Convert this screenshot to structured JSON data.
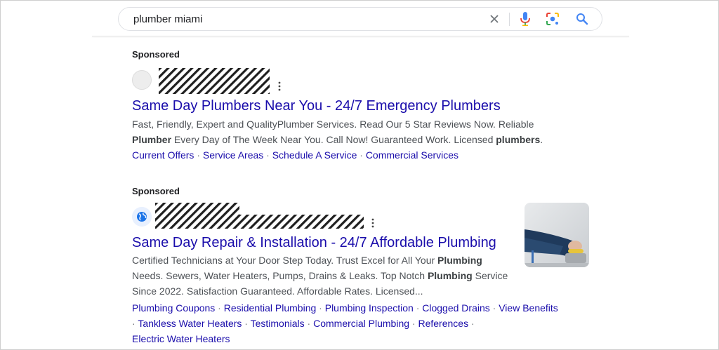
{
  "search": {
    "query": "plumber miami",
    "icons": [
      "close-icon",
      "mic-icon",
      "camera-lens-icon",
      "search-icon"
    ]
  },
  "ads": [
    {
      "sponsored_label": "Sponsored",
      "favicon": "blank-favicon",
      "title": "Same Day Plumbers Near You - 24/7 Emergency Plumbers",
      "description_lines": [
        [
          {
            "t": "Fast, Friendly, Expert and QualityPlumber Services. Read Our 5 Star Reviews Now. Reliable",
            "b": false
          }
        ],
        [
          {
            "t": "Plumber",
            "b": true
          },
          {
            "t": " Every Day of The Week Near You. Call Now! Guaranteed Work. Licensed ",
            "b": false
          },
          {
            "t": "plumbers",
            "b": true
          },
          {
            "t": ".",
            "b": false
          }
        ]
      ],
      "sitelink_lines": [
        [
          "Current Offers",
          "Service Areas",
          "Schedule A Service",
          "Commercial Services"
        ]
      ]
    },
    {
      "sponsored_label": "Sponsored",
      "favicon": "globe-favicon",
      "title": "Same Day Repair & Installation - 24/7 Affordable Plumbing",
      "description_lines": [
        [
          {
            "t": "Certified Technicians at Your Door Step Today. Trust Excel for All Your ",
            "b": false
          },
          {
            "t": "Plumbing",
            "b": true
          }
        ],
        [
          {
            "t": "Needs. Sewers, Water Heaters, Pumps, Drains & Leaks. Top Notch ",
            "b": false
          },
          {
            "t": "Plumbing",
            "b": true
          },
          {
            "t": " Service",
            "b": false
          }
        ],
        [
          {
            "t": "Since 2022. Satisfaction Guaranteed. Affordable Rates. Licensed...",
            "b": false
          }
        ]
      ],
      "sitelink_lines": [
        [
          "Plumbing Coupons",
          "Residential Plumbing",
          "Plumbing Inspection",
          "Clogged Drains",
          "View Benefits"
        ],
        [
          "Tankless Water Heaters",
          "Testimonials",
          "Commercial Plumbing",
          "References"
        ],
        [
          "Electric Water Heaters"
        ]
      ],
      "trailing_separators": [
        true,
        true,
        false
      ],
      "leading_separator_line": 1,
      "thumbnail": "plumber-working-photo"
    }
  ],
  "colors": {
    "link": "#1a0dab",
    "text": "#4d5156",
    "mic_blue": "#4285f4",
    "mic_red": "#ea4335",
    "lens_yellow": "#fbbc04",
    "lens_green": "#34a853"
  }
}
